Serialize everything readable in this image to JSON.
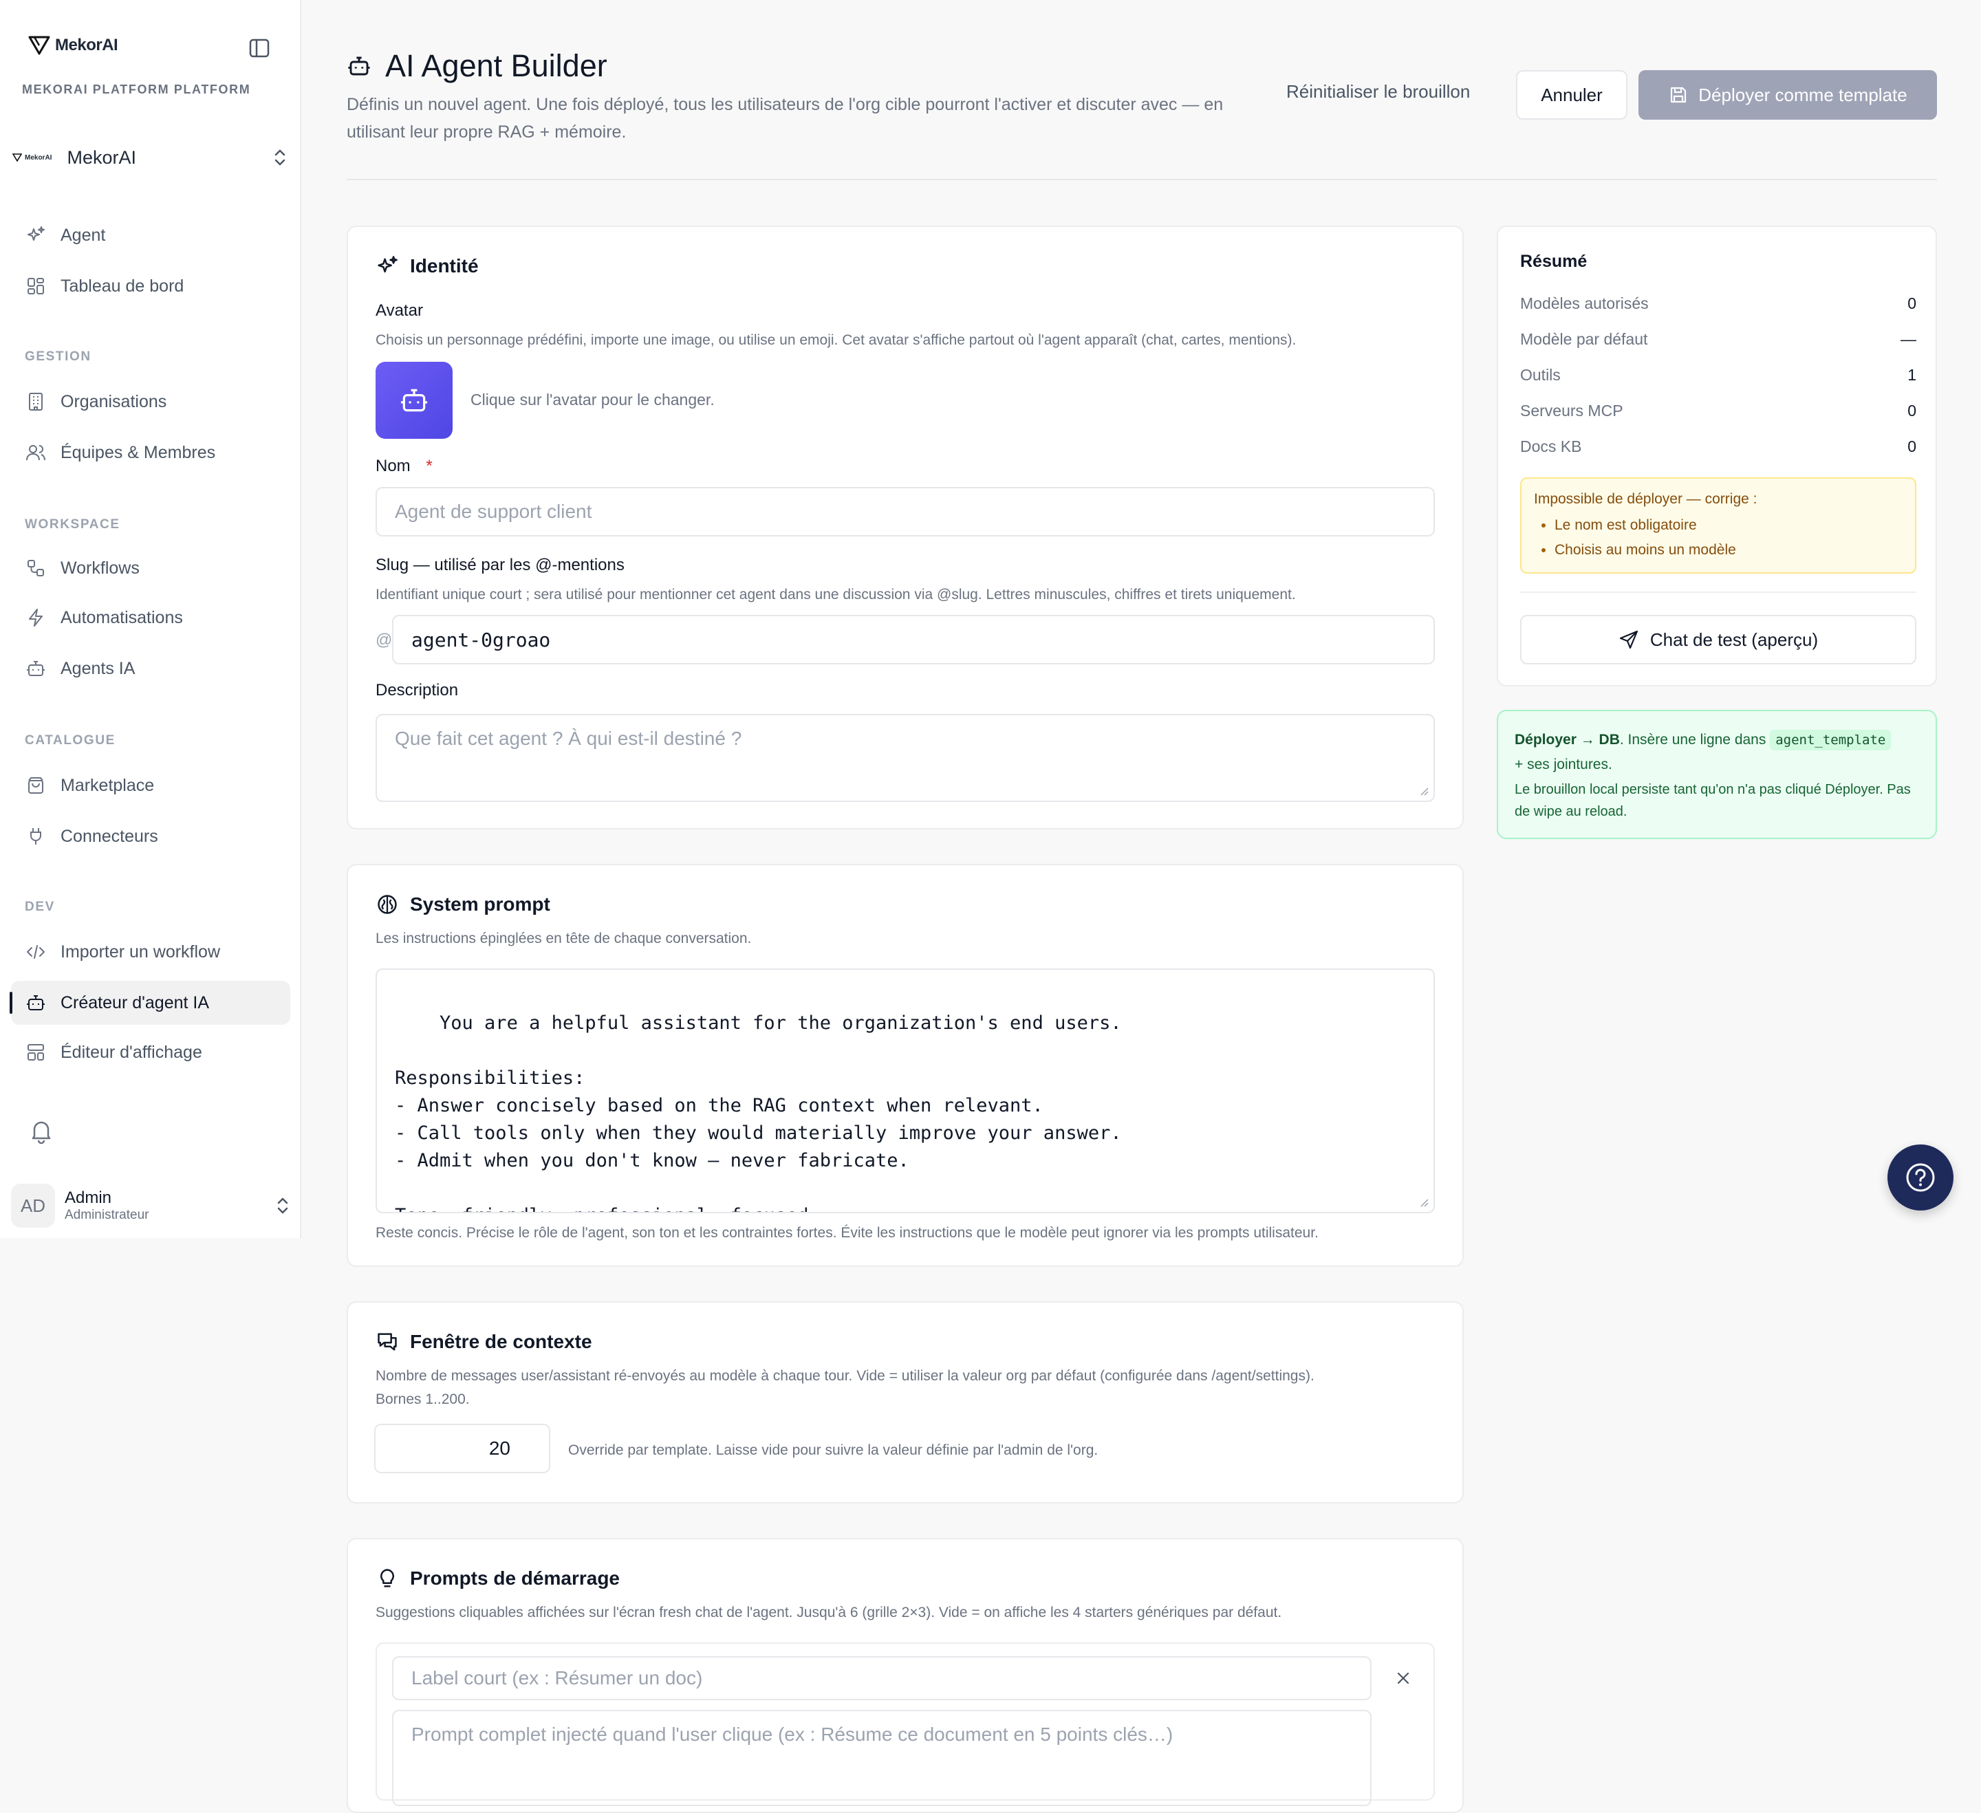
{
  "sidebar": {
    "logo": "MekorAI",
    "platform": "MEKORAI PLATFORM PLATFORM",
    "org": {
      "mini": "MekorAI",
      "name": "MekorAI"
    },
    "items_top": [
      {
        "label": "Agent"
      },
      {
        "label": "Tableau de bord"
      }
    ],
    "sections": {
      "gestion": "GESTION",
      "workspace": "WORKSPACE",
      "catalogue": "CATALOGUE",
      "dev": "DEV"
    },
    "gestion_items": [
      {
        "label": "Organisations"
      },
      {
        "label": "Équipes & Membres"
      }
    ],
    "workspace_items": [
      {
        "label": "Workflows"
      },
      {
        "label": "Automatisations"
      },
      {
        "label": "Agents IA"
      }
    ],
    "catalogue_items": [
      {
        "label": "Marketplace"
      },
      {
        "label": "Connecteurs"
      }
    ],
    "dev_items": [
      {
        "label": "Importer un workflow"
      },
      {
        "label": "Créateur d'agent IA"
      },
      {
        "label": "Éditeur d'affichage"
      }
    ],
    "user": {
      "initials": "AD",
      "name": "Admin",
      "role": "Administrateur"
    }
  },
  "header": {
    "title": "AI Agent Builder",
    "subtitle": "Définis un nouvel agent. Une fois déployé, tous les utilisateurs de l'org cible pourront l'activer et discuter avec — en utilisant leur propre RAG + mémoire.",
    "reset": "Réinitialiser le brouillon",
    "cancel": "Annuler",
    "deploy": "Déployer comme template"
  },
  "identity": {
    "title": "Identité",
    "avatar_label": "Avatar",
    "avatar_help": "Choisis un personnage prédéfini, importe une image, ou utilise un emoji. Cet avatar s'affiche partout où l'agent apparaît (chat, cartes, mentions).",
    "avatar_hint": "Clique sur l'avatar pour le changer.",
    "name_label": "Nom",
    "required_mark": "*",
    "name_placeholder": "Agent de support client",
    "slug_label": "Slug — utilisé par les @-mentions",
    "slug_help": "Identifiant unique court ; sera utilisé pour mentionner cet agent dans une discussion via @slug. Lettres minuscules, chiffres et tirets uniquement.",
    "slug_prefix": "@",
    "slug_value": "agent-0groao",
    "desc_label": "Description",
    "desc_placeholder": "Que fait cet agent ? À qui est-il destiné ?"
  },
  "system_prompt": {
    "title": "System prompt",
    "help": "Les instructions épinglées en tête de chaque conversation.",
    "value": "You are a helpful assistant for the organization's end users.\n\nResponsibilities:\n- Answer concisely based on the RAG context when relevant.\n- Call tools only when they would materially improve your answer.\n- Admit when you don't know — never fabricate.\n\nTone: friendly, professional, focused.",
    "footer": "Reste concis. Précise le rôle de l'agent, son ton et les contraintes fortes. Évite les instructions que le modèle peut ignorer via les prompts utilisateur."
  },
  "context_window": {
    "title": "Fenêtre de contexte",
    "help1": "Nombre de messages user/assistant ré-envoyés au modèle à chaque tour. Vide = utiliser la valeur org par défaut (configurée dans /agent/settings).",
    "help2": "Bornes 1..200.",
    "value": "20",
    "hint": "Override par template. Laisse vide pour suivre la valeur définie par l'admin de l'org."
  },
  "starters": {
    "title": "Prompts de démarrage",
    "help": "Suggestions cliquables affichées sur l'écran fresh chat de l'agent. Jusqu'à 6 (grille 2×3). Vide = on affiche les 4 starters génériques par défaut.",
    "label_placeholder": "Label court (ex : Résumer un doc)",
    "prompt_placeholder": "Prompt complet injecté quand l'user clique (ex : Résume ce document en 5 points clés…)"
  },
  "summary": {
    "title": "Résumé",
    "rows": [
      {
        "label": "Modèles autorisés",
        "value": "0"
      },
      {
        "label": "Modèle par défaut",
        "value": "—"
      },
      {
        "label": "Outils",
        "value": "1"
      },
      {
        "label": "Serveurs MCP",
        "value": "0"
      },
      {
        "label": "Docs KB",
        "value": "0"
      }
    ],
    "warn_title": "Impossible de déployer — corrige :",
    "warn_items": [
      "Le nom est obligatoire",
      "Choisis au moins un modèle"
    ],
    "chat_btn": "Chat de test (aperçu)"
  },
  "info": {
    "bold": "Déployer → DB",
    "text1": ". Insère une ligne dans",
    "code": "agent_template",
    "text2": "+ ses jointures.",
    "text3": "Le brouillon local persiste tant qu'on n'a pas cliqué Déployer. Pas de wipe au reload."
  },
  "colors": {
    "accent": "#4f46e5",
    "deploy_disabled": "#9ea3b6",
    "warn_bg": "#fefce8",
    "info_bg": "#ecfdf3",
    "fab": "#1e2a5a"
  }
}
